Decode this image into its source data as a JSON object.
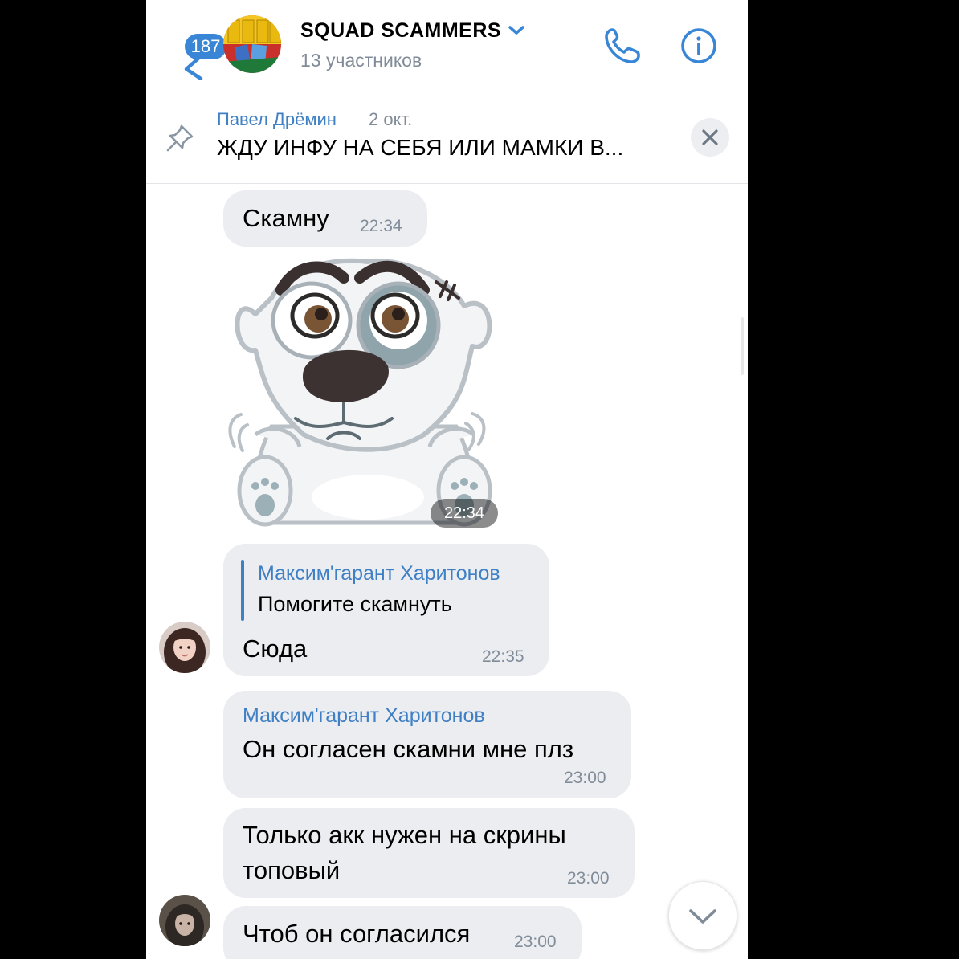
{
  "header": {
    "unread_count": "187",
    "title": "SQUAD SCAMMERS",
    "subtitle": "13 участников"
  },
  "pinned": {
    "author": "Павел Дрёмин",
    "date": "2 окт.",
    "text": "ЖДУ ИНФУ НА СЕБЯ ИЛИ МАМКИ В..."
  },
  "messages": [
    {
      "text": "Скамну",
      "time": "22:34"
    },
    {
      "type": "sticker",
      "time": "22:34"
    },
    {
      "reply_author": "Максим'гарант Харитонов",
      "reply_text": "Помогите скамнуть",
      "text": "Сюда",
      "time": "22:35"
    },
    {
      "author": "Максим'гарант Харитонов",
      "text": "Он согласен скамни мне плз",
      "time": "23:00"
    },
    {
      "text_line1": "Только акк нужен на скрины",
      "text_line2": "топовый",
      "time": "23:00"
    },
    {
      "text": "Чтоб он согласился",
      "time": "23:00"
    }
  ],
  "colors": {
    "accent": "#3a86d6",
    "link": "#3f7fc4",
    "bubble": "#ebedf0",
    "secondary_text": "#818c99"
  },
  "icons": [
    "back-chevron-icon",
    "chevron-down-icon",
    "phone-icon",
    "info-icon",
    "pin-icon",
    "close-icon",
    "scroll-down-icon"
  ]
}
